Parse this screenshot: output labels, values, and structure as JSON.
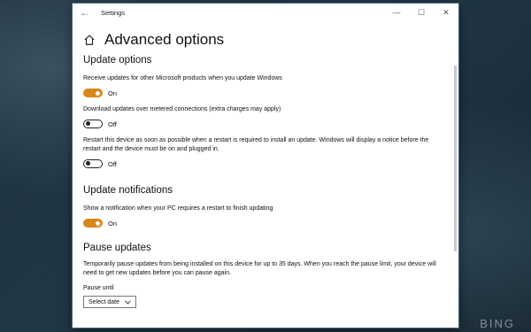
{
  "window": {
    "title": "Settings",
    "back": "←",
    "caption": {
      "minimize": "—",
      "maximize": "☐",
      "close": "✕"
    }
  },
  "page": {
    "title": "Advanced options",
    "icon": "home-icon"
  },
  "update_options": {
    "heading": "Update options",
    "items": [
      {
        "text": "Receive updates for other Microsoft products when you update Windows",
        "state": "On",
        "on": true
      },
      {
        "text": "Download updates over metered connections (extra charges may apply)",
        "state": "Off",
        "on": false
      },
      {
        "text": "Restart this device as soon as possible when a restart is required to install an update. Windows will display a notice before the restart and the device must be on and plugged in.",
        "state": "Off",
        "on": false
      }
    ]
  },
  "update_notifications": {
    "heading": "Update notifications",
    "items": [
      {
        "text": "Show a notification when your PC requires a restart to finish updating",
        "state": "On",
        "on": true
      }
    ]
  },
  "pause_updates": {
    "heading": "Pause updates",
    "description": "Temporarily pause updates from being installed on this device for up to 35 days. When you reach the pause limit, your device will need to get new updates before you can pause again.",
    "pause_until_label": "Pause until",
    "select_value": "Select date",
    "select_icon": "chevron-down-icon"
  },
  "desktop": {
    "watermark": "BING"
  },
  "colors": {
    "accent": "#d9861a"
  }
}
